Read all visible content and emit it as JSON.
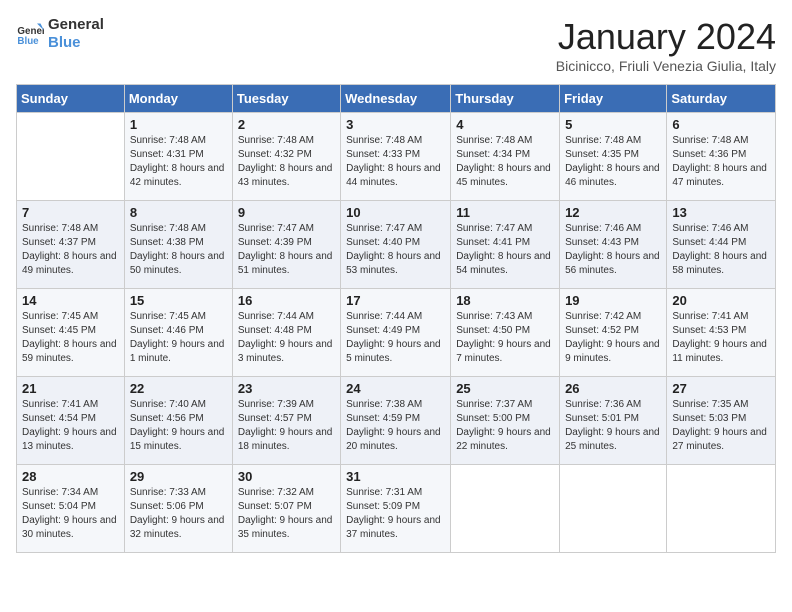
{
  "logo": {
    "text_general": "General",
    "text_blue": "Blue"
  },
  "title": "January 2024",
  "subtitle": "Bicinicco, Friuli Venezia Giulia, Italy",
  "headers": [
    "Sunday",
    "Monday",
    "Tuesday",
    "Wednesday",
    "Thursday",
    "Friday",
    "Saturday"
  ],
  "weeks": [
    [
      {
        "day": "",
        "sunrise": "",
        "sunset": "",
        "daylight": ""
      },
      {
        "day": "1",
        "sunrise": "Sunrise: 7:48 AM",
        "sunset": "Sunset: 4:31 PM",
        "daylight": "Daylight: 8 hours and 42 minutes."
      },
      {
        "day": "2",
        "sunrise": "Sunrise: 7:48 AM",
        "sunset": "Sunset: 4:32 PM",
        "daylight": "Daylight: 8 hours and 43 minutes."
      },
      {
        "day": "3",
        "sunrise": "Sunrise: 7:48 AM",
        "sunset": "Sunset: 4:33 PM",
        "daylight": "Daylight: 8 hours and 44 minutes."
      },
      {
        "day": "4",
        "sunrise": "Sunrise: 7:48 AM",
        "sunset": "Sunset: 4:34 PM",
        "daylight": "Daylight: 8 hours and 45 minutes."
      },
      {
        "day": "5",
        "sunrise": "Sunrise: 7:48 AM",
        "sunset": "Sunset: 4:35 PM",
        "daylight": "Daylight: 8 hours and 46 minutes."
      },
      {
        "day": "6",
        "sunrise": "Sunrise: 7:48 AM",
        "sunset": "Sunset: 4:36 PM",
        "daylight": "Daylight: 8 hours and 47 minutes."
      }
    ],
    [
      {
        "day": "7",
        "sunrise": "Sunrise: 7:48 AM",
        "sunset": "Sunset: 4:37 PM",
        "daylight": "Daylight: 8 hours and 49 minutes."
      },
      {
        "day": "8",
        "sunrise": "Sunrise: 7:48 AM",
        "sunset": "Sunset: 4:38 PM",
        "daylight": "Daylight: 8 hours and 50 minutes."
      },
      {
        "day": "9",
        "sunrise": "Sunrise: 7:47 AM",
        "sunset": "Sunset: 4:39 PM",
        "daylight": "Daylight: 8 hours and 51 minutes."
      },
      {
        "day": "10",
        "sunrise": "Sunrise: 7:47 AM",
        "sunset": "Sunset: 4:40 PM",
        "daylight": "Daylight: 8 hours and 53 minutes."
      },
      {
        "day": "11",
        "sunrise": "Sunrise: 7:47 AM",
        "sunset": "Sunset: 4:41 PM",
        "daylight": "Daylight: 8 hours and 54 minutes."
      },
      {
        "day": "12",
        "sunrise": "Sunrise: 7:46 AM",
        "sunset": "Sunset: 4:43 PM",
        "daylight": "Daylight: 8 hours and 56 minutes."
      },
      {
        "day": "13",
        "sunrise": "Sunrise: 7:46 AM",
        "sunset": "Sunset: 4:44 PM",
        "daylight": "Daylight: 8 hours and 58 minutes."
      }
    ],
    [
      {
        "day": "14",
        "sunrise": "Sunrise: 7:45 AM",
        "sunset": "Sunset: 4:45 PM",
        "daylight": "Daylight: 8 hours and 59 minutes."
      },
      {
        "day": "15",
        "sunrise": "Sunrise: 7:45 AM",
        "sunset": "Sunset: 4:46 PM",
        "daylight": "Daylight: 9 hours and 1 minute."
      },
      {
        "day": "16",
        "sunrise": "Sunrise: 7:44 AM",
        "sunset": "Sunset: 4:48 PM",
        "daylight": "Daylight: 9 hours and 3 minutes."
      },
      {
        "day": "17",
        "sunrise": "Sunrise: 7:44 AM",
        "sunset": "Sunset: 4:49 PM",
        "daylight": "Daylight: 9 hours and 5 minutes."
      },
      {
        "day": "18",
        "sunrise": "Sunrise: 7:43 AM",
        "sunset": "Sunset: 4:50 PM",
        "daylight": "Daylight: 9 hours and 7 minutes."
      },
      {
        "day": "19",
        "sunrise": "Sunrise: 7:42 AM",
        "sunset": "Sunset: 4:52 PM",
        "daylight": "Daylight: 9 hours and 9 minutes."
      },
      {
        "day": "20",
        "sunrise": "Sunrise: 7:41 AM",
        "sunset": "Sunset: 4:53 PM",
        "daylight": "Daylight: 9 hours and 11 minutes."
      }
    ],
    [
      {
        "day": "21",
        "sunrise": "Sunrise: 7:41 AM",
        "sunset": "Sunset: 4:54 PM",
        "daylight": "Daylight: 9 hours and 13 minutes."
      },
      {
        "day": "22",
        "sunrise": "Sunrise: 7:40 AM",
        "sunset": "Sunset: 4:56 PM",
        "daylight": "Daylight: 9 hours and 15 minutes."
      },
      {
        "day": "23",
        "sunrise": "Sunrise: 7:39 AM",
        "sunset": "Sunset: 4:57 PM",
        "daylight": "Daylight: 9 hours and 18 minutes."
      },
      {
        "day": "24",
        "sunrise": "Sunrise: 7:38 AM",
        "sunset": "Sunset: 4:59 PM",
        "daylight": "Daylight: 9 hours and 20 minutes."
      },
      {
        "day": "25",
        "sunrise": "Sunrise: 7:37 AM",
        "sunset": "Sunset: 5:00 PM",
        "daylight": "Daylight: 9 hours and 22 minutes."
      },
      {
        "day": "26",
        "sunrise": "Sunrise: 7:36 AM",
        "sunset": "Sunset: 5:01 PM",
        "daylight": "Daylight: 9 hours and 25 minutes."
      },
      {
        "day": "27",
        "sunrise": "Sunrise: 7:35 AM",
        "sunset": "Sunset: 5:03 PM",
        "daylight": "Daylight: 9 hours and 27 minutes."
      }
    ],
    [
      {
        "day": "28",
        "sunrise": "Sunrise: 7:34 AM",
        "sunset": "Sunset: 5:04 PM",
        "daylight": "Daylight: 9 hours and 30 minutes."
      },
      {
        "day": "29",
        "sunrise": "Sunrise: 7:33 AM",
        "sunset": "Sunset: 5:06 PM",
        "daylight": "Daylight: 9 hours and 32 minutes."
      },
      {
        "day": "30",
        "sunrise": "Sunrise: 7:32 AM",
        "sunset": "Sunset: 5:07 PM",
        "daylight": "Daylight: 9 hours and 35 minutes."
      },
      {
        "day": "31",
        "sunrise": "Sunrise: 7:31 AM",
        "sunset": "Sunset: 5:09 PM",
        "daylight": "Daylight: 9 hours and 37 minutes."
      },
      {
        "day": "",
        "sunrise": "",
        "sunset": "",
        "daylight": ""
      },
      {
        "day": "",
        "sunrise": "",
        "sunset": "",
        "daylight": ""
      },
      {
        "day": "",
        "sunrise": "",
        "sunset": "",
        "daylight": ""
      }
    ]
  ]
}
